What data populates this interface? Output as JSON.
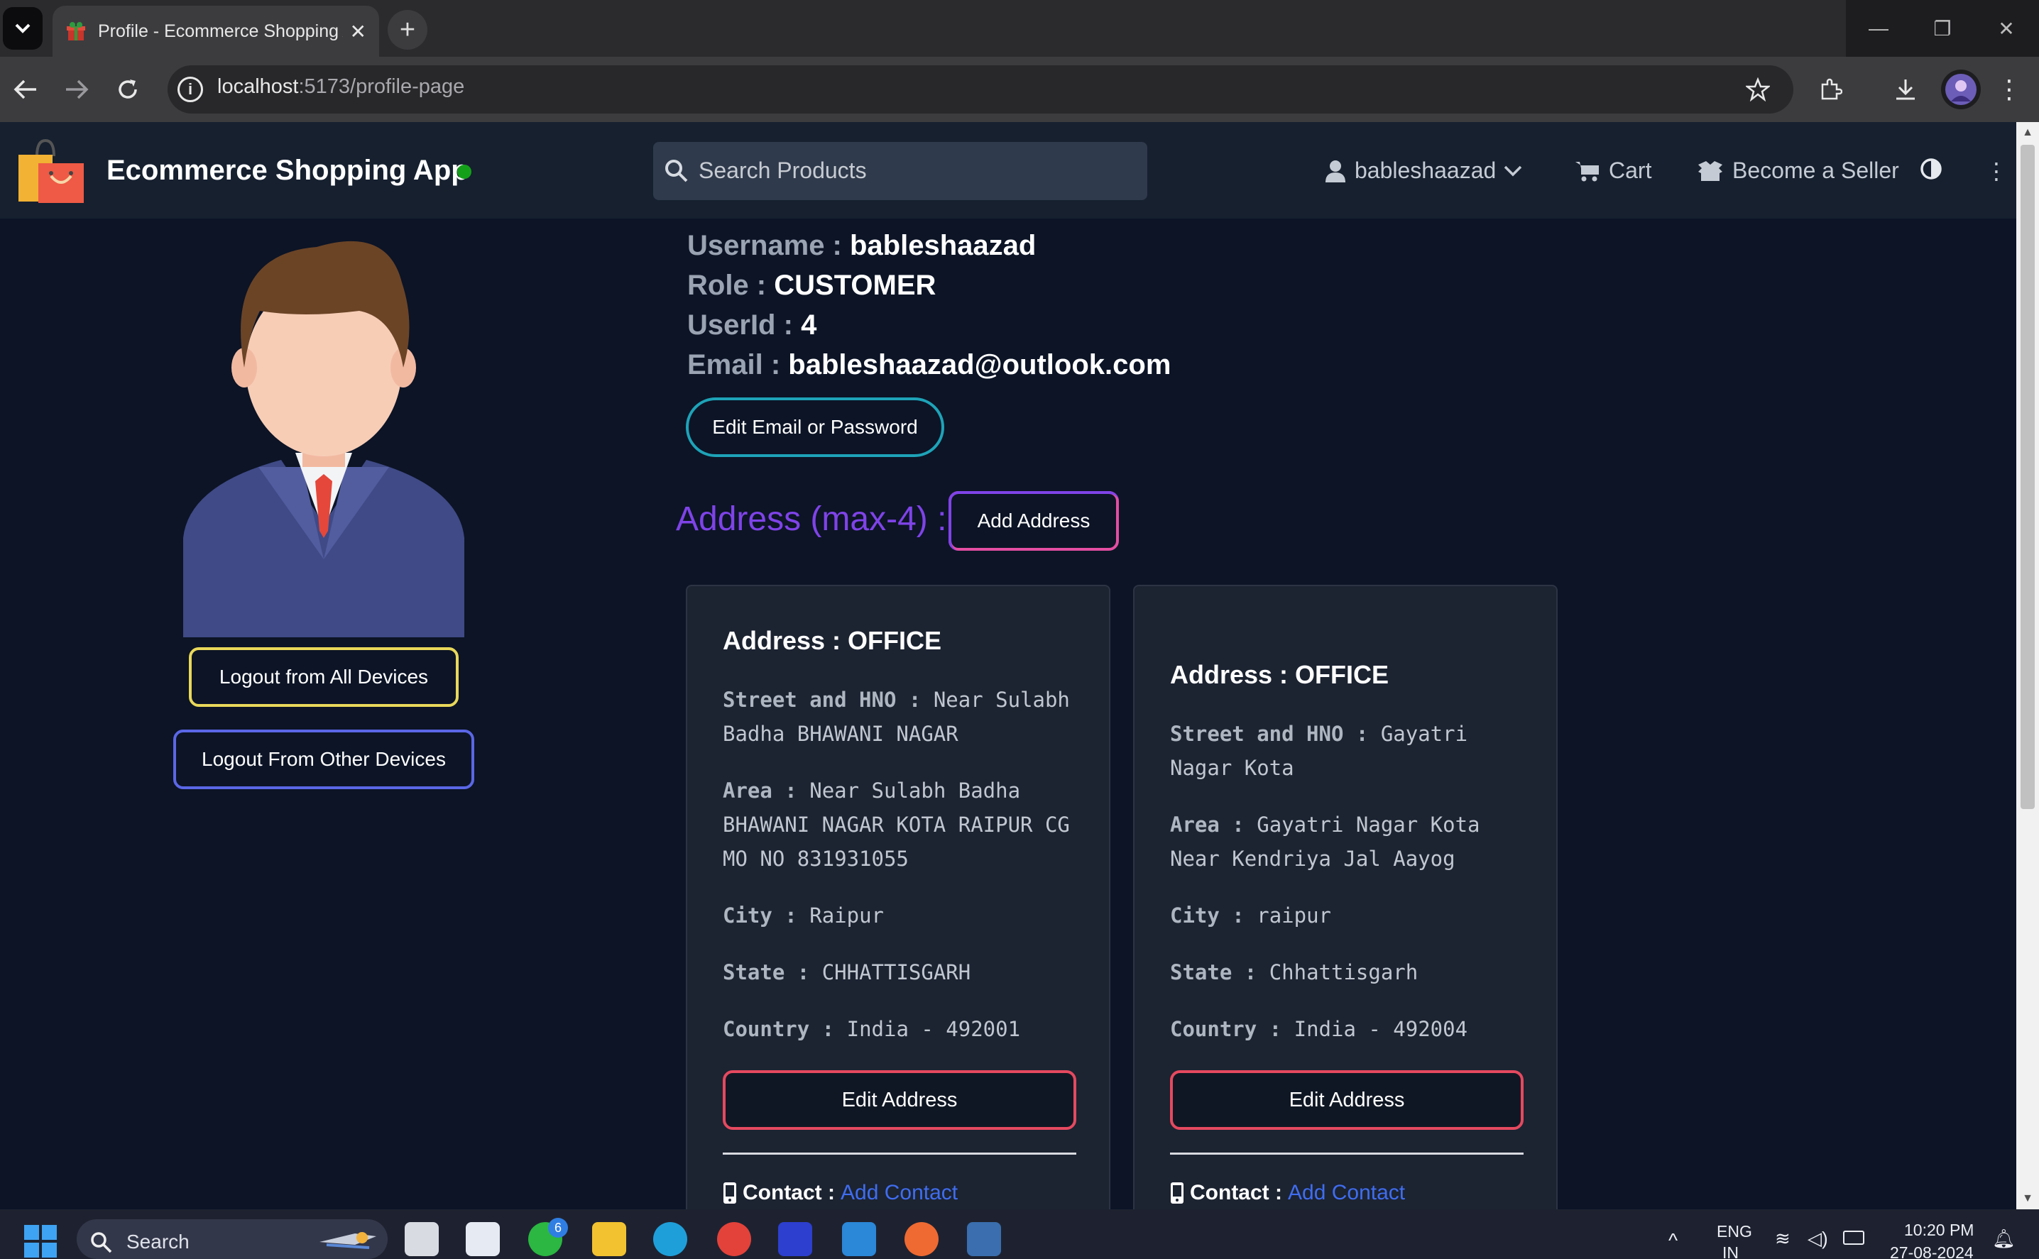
{
  "browser": {
    "tab_title": "Profile - Ecommerce Shopping A",
    "url_host": "localhost",
    "url_rest": ":5173/profile-page"
  },
  "header": {
    "app_title": "Ecommerce Shopping App",
    "search_placeholder": "Search Products",
    "username": "bableshaazad",
    "cart": "Cart",
    "become_seller": "Become a Seller"
  },
  "profile": {
    "username_label": "Username :",
    "username": "bableshaazad",
    "role_label": "Role :",
    "role": "CUSTOMER",
    "userid_label": "UserId :",
    "userid": "4",
    "email_label": "Email :",
    "email": "bableshaazad@outlook.com",
    "edit_email_button": "Edit Email or Password"
  },
  "left": {
    "logout_all": "Logout from All Devices",
    "logout_other": "Logout From Other Devices"
  },
  "address_section": {
    "heading": "Address (max-4) :",
    "add_button": "Add Address"
  },
  "addresses": [
    {
      "title": "Address : OFFICE",
      "street_label": "Street and HNO :",
      "street": "Near Sulabh Badha BHAWANI NAGAR",
      "area_label": "Area :",
      "area": "Near Sulabh Badha BHAWANI NAGAR KOTA RAIPUR CG MO NO 831931055",
      "city_label": "City :",
      "city": "Raipur",
      "state_label": "State :",
      "state": "CHHATTISGARH",
      "country_label": "Country :",
      "country": "India - 492001",
      "edit_button": "Edit Address",
      "contact_label": "Contact :",
      "contact_link": "Add Contact"
    },
    {
      "title": "Address : OFFICE",
      "street_label": "Street and HNO :",
      "street": "Gayatri Nagar Kota",
      "area_label": "Area :",
      "area": "Gayatri Nagar Kota Near Kendriya Jal Aayog",
      "city_label": "City :",
      "city": "raipur",
      "state_label": "State :",
      "state": "Chhattisgarh",
      "country_label": "Country :",
      "country": "India - 492004",
      "edit_button": "Edit Address",
      "contact_label": "Contact :",
      "contact_link": "Add Contact"
    }
  ],
  "taskbar": {
    "search": "Search",
    "whatsapp_badge": "6",
    "lang": "ENG",
    "region": "IN",
    "time": "10:20 PM",
    "date": "27-08-2024"
  },
  "colors": {
    "page_bg": "#0c1426",
    "header_bg": "#16202f",
    "card_bg": "#1c2331",
    "accent_purple": "#7f43e8",
    "link_blue": "#3f6df0"
  }
}
